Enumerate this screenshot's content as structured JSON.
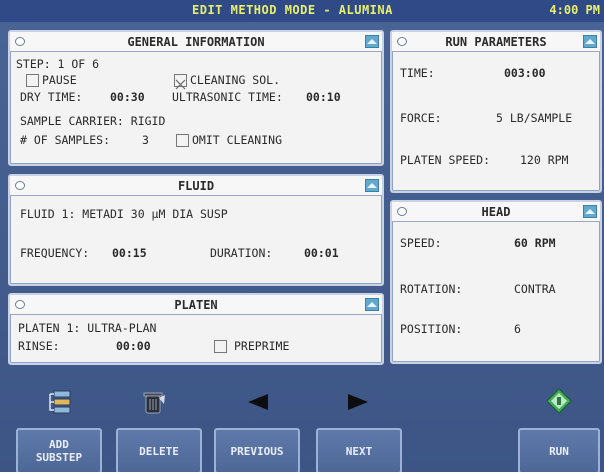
{
  "titlebar": {
    "title": "EDIT METHOD MODE - ALUMINA",
    "clock": "4:00 PM"
  },
  "general": {
    "title": "GENERAL INFORMATION",
    "step": "STEP:  1 OF 6",
    "pause_label": "PAUSE",
    "pause_checked": false,
    "cleaning_label": "CLEANING SOL.",
    "cleaning_checked": true,
    "dry_time_label": "DRY TIME:",
    "dry_time_value": "00:30",
    "ultrasonic_label": "ULTRASONIC TIME:",
    "ultrasonic_value": "00:10",
    "carrier": "SAMPLE CARRIER: RIGID",
    "samples_label": "# OF SAMPLES:",
    "samples_value": "3",
    "omit_label": "OMIT CLEANING",
    "omit_checked": false
  },
  "run": {
    "title": "RUN PARAMETERS",
    "time_label": "TIME:",
    "time_value": "003:00",
    "force_label": "FORCE:",
    "force_value": "5 LB/SAMPLE",
    "platen_speed_label": "PLATEN SPEED:",
    "platen_speed_value": "120 RPM"
  },
  "fluid": {
    "title": "FLUID",
    "fluid1": "FLUID 1:  METADI 30 µM DIA SUSP",
    "frequency_label": "FREQUENCY:",
    "frequency_value": "00:15",
    "duration_label": "DURATION:",
    "duration_value": "00:01"
  },
  "head": {
    "title": "HEAD",
    "speed_label": "SPEED:",
    "speed_value": "60 RPM",
    "rotation_label": "ROTATION:",
    "rotation_value": "CONTRA",
    "position_label": "POSITION:",
    "position_value": "6"
  },
  "platen": {
    "title": "PLATEN",
    "platen1": "PLATEN 1:  ULTRA-PLAN",
    "rinse_label": "RINSE:",
    "rinse_value": "00:00",
    "preprime_label": "PREPRIME",
    "preprime_checked": false
  },
  "toolbar": {
    "add_substep_line1": "ADD",
    "add_substep_line2": "SUBSTEP",
    "delete_label": "DELETE",
    "previous_label": "PREVIOUS",
    "next_label": "NEXT",
    "run_label": "RUN"
  },
  "icons": {
    "add_substep": "stacked-layers-icon",
    "delete": "trash-bin-icon",
    "previous": "left-arrow-icon",
    "next": "right-arrow-icon",
    "run": "diamond-run-icon"
  },
  "colors": {
    "background": "#3f5a8a",
    "titlebar_text": "#e8f06a",
    "panel_bg": "#f3f3f3",
    "collapse_icon": "#62a9cf",
    "run_icon": "#3fae5a"
  }
}
